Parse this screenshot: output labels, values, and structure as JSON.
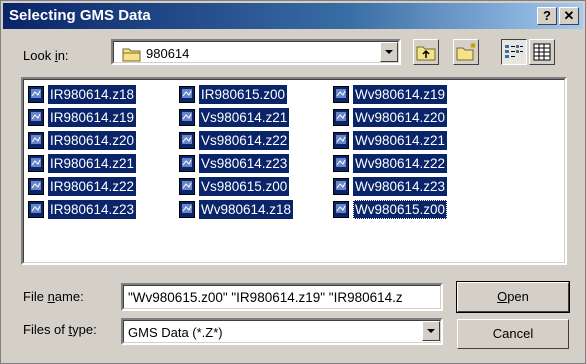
{
  "window": {
    "title": "Selecting GMS Data",
    "help_label": "?",
    "close_label": "✕"
  },
  "lookin": {
    "label_prefix": "Look ",
    "label_accel": "i",
    "label_suffix": "n:",
    "value": "980614"
  },
  "files": [
    {
      "name": "IR980614.z18",
      "icon": "file-icon"
    },
    {
      "name": "IR980614.z19",
      "icon": "file-icon"
    },
    {
      "name": "IR980614.z20",
      "icon": "file-icon"
    },
    {
      "name": "IR980614.z21",
      "icon": "file-icon"
    },
    {
      "name": "IR980614.z22",
      "icon": "file-icon"
    },
    {
      "name": "IR980614.z23",
      "icon": "file-icon"
    },
    {
      "name": "IR980615.z00",
      "icon": "file-icon"
    },
    {
      "name": "Vs980614.z21",
      "icon": "file-icon"
    },
    {
      "name": "Vs980614.z22",
      "icon": "file-icon"
    },
    {
      "name": "Vs980614.z23",
      "icon": "file-icon"
    },
    {
      "name": "Vs980615.z00",
      "icon": "file-icon"
    },
    {
      "name": "Wv980614.z18",
      "icon": "file-icon"
    },
    {
      "name": "Wv980614.z19",
      "icon": "file-icon"
    },
    {
      "name": "Wv980614.z20",
      "icon": "file-icon"
    },
    {
      "name": "Wv980614.z21",
      "icon": "file-icon"
    },
    {
      "name": "Wv980614.z22",
      "icon": "file-icon"
    },
    {
      "name": "Wv980614.z23",
      "icon": "file-icon"
    },
    {
      "name": "Wv980615.z00",
      "icon": "file-icon"
    }
  ],
  "filename": {
    "label_prefix": "File ",
    "label_accel": "n",
    "label_suffix": "ame:",
    "value": "\"Wv980615.z00\" \"IR980614.z19\" \"IR980614.z"
  },
  "filetype": {
    "label_prefix": "Files of ",
    "label_accel": "t",
    "label_suffix": "ype:",
    "value": "GMS Data (*.Z*)"
  },
  "buttons": {
    "open_accel": "O",
    "open_rest": "pen",
    "cancel": "Cancel"
  },
  "colors": {
    "selection": "#0a246a",
    "face": "#d4d0c8"
  }
}
